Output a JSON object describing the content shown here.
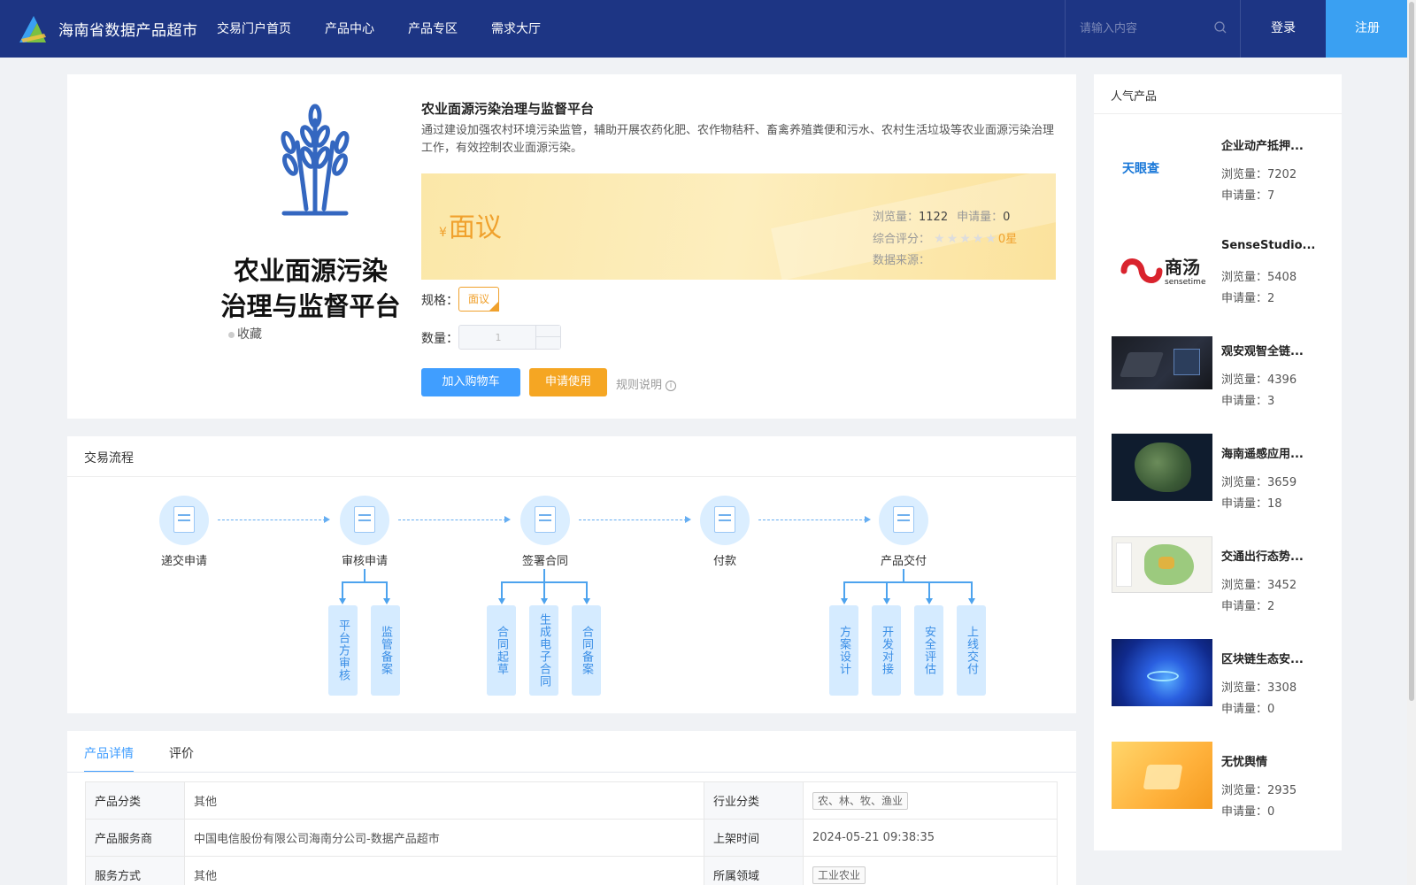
{
  "header": {
    "brand": "海南省数据产品超市",
    "nav": [
      "交易门户首页",
      "产品中心",
      "产品专区",
      "需求大厅"
    ],
    "search_placeholder": "请输入内容",
    "login": "登录",
    "register": "注册"
  },
  "product": {
    "image_title_line1": "农业面源污染",
    "image_title_line2": "治理与监督平台",
    "favorite": "收藏",
    "title": "农业面源污染治理与监督平台",
    "description": "通过建设加强农村环境污染监管，辅助开展农药化肥、农作物秸秆、畜禽养殖粪便和污水、农村生活垃圾等农业面源污染治理工作，有效控制农业面源污染。",
    "currency": "¥",
    "price": "面议",
    "views_label": "浏览量：",
    "views": "1122",
    "applications_label": "申请量：",
    "applications": "0",
    "rating_label": "综合评分：",
    "rating_stars": "★★★★★",
    "rating_value": "0星",
    "rating": 0,
    "source_label": "数据来源：",
    "spec_label": "规格：",
    "spec_value": "面议",
    "qty_label": "数量：",
    "qty_value": "1",
    "btn_cart": "加入购物车",
    "btn_apply": "申请使用",
    "rules": "规则说明"
  },
  "process": {
    "title": "交易流程",
    "steps": [
      "递交申请",
      "审核申请",
      "签署合同",
      "付款",
      "产品交付"
    ],
    "sub_review": [
      "平台方审核",
      "监管备案"
    ],
    "sub_contract": [
      "合同起草",
      "生成电子合同",
      "合同备案"
    ],
    "sub_delivery": [
      "方案设计",
      "开发对接",
      "安全评估",
      "上线交付"
    ]
  },
  "details": {
    "tabs": [
      "产品详情",
      "评价"
    ],
    "rows": [
      {
        "k1": "产品分类",
        "v1": "其他",
        "k2": "行业分类",
        "v2": "农、林、牧、渔业"
      },
      {
        "k1": "产品服务商",
        "v1": "中国电信股份有限公司海南分公司-数据产品超市",
        "k2": "上架时间",
        "v2": "2024-05-21 09:38:35"
      },
      {
        "k1": "服务方式",
        "v1": "其他",
        "k2": "所属领域",
        "v2": "工业农业"
      }
    ]
  },
  "sidebar": {
    "title": "人气产品",
    "views_label": "浏览量：",
    "apps_label": "申请量：",
    "items": [
      {
        "name": "企业动产抵押...",
        "views": "7202",
        "apps": "7",
        "thumb": "tianyancha"
      },
      {
        "name": "SenseStudio...",
        "views": "5408",
        "apps": "2",
        "thumb": "sensetime"
      },
      {
        "name": "观安观智全链...",
        "views": "4396",
        "apps": "3",
        "thumb": "dark-ui"
      },
      {
        "name": "海南遥感应用...",
        "views": "3659",
        "apps": "18",
        "thumb": "satellite-map"
      },
      {
        "name": "交通出行态势...",
        "views": "3452",
        "apps": "2",
        "thumb": "traffic-map"
      },
      {
        "name": "区块链生态安...",
        "views": "3308",
        "apps": "0",
        "thumb": "blockchain"
      },
      {
        "name": "无忧舆情",
        "views": "2935",
        "apps": "0",
        "thumb": "orange-3d"
      }
    ],
    "thumb_texts": {
      "tianyancha": "天眼查",
      "sensetime": "商汤",
      "sensetime_sub": "sensetime"
    }
  }
}
